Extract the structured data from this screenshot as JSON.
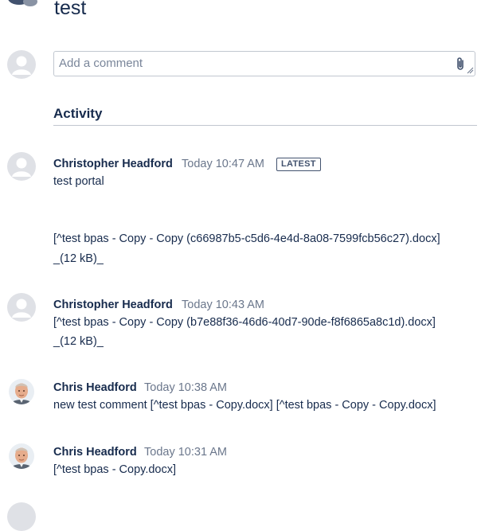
{
  "header": {
    "title": "test"
  },
  "comment_input": {
    "placeholder": "Add a comment",
    "value": ""
  },
  "activity": {
    "title": "Activity"
  },
  "entries": [
    {
      "author": "Christopher Headford",
      "time": "Today 10:47 AM",
      "badge": "LATEST",
      "lines": [
        "test portal",
        "[^test bpas - Copy - Copy (c66987b5-c5d6-4e4d-8a08-7599fcb56c27).docx]",
        "_(12 kB)_"
      ]
    },
    {
      "author": "Christopher Headford",
      "time": "Today 10:43 AM",
      "lines": [
        "[^test bpas - Copy - Copy (b7e88f36-46d6-40d7-90de-f8f6865a8c1d).docx]",
        "_(12 kB)_"
      ]
    },
    {
      "author": "Chris Headford",
      "time": "Today 10:38 AM",
      "lines": [
        "new test comment [^test bpas - Copy.docx] [^test bpas - Copy - Copy.docx]"
      ]
    },
    {
      "author": "Chris Headford",
      "time": "Today 10:31 AM",
      "lines": [
        "[^test bpas - Copy.docx]"
      ]
    }
  ]
}
